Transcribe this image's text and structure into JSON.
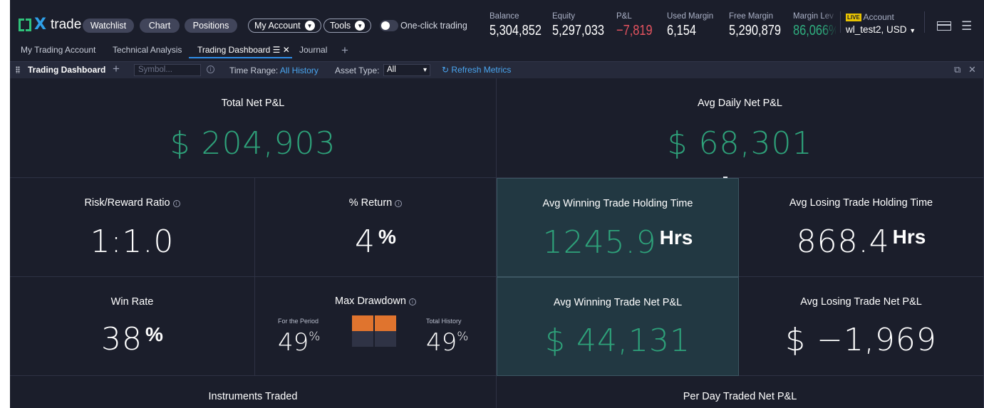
{
  "app": {
    "logo_text": "trade"
  },
  "nav": {
    "buttons": [
      "Watchlist",
      "Chart",
      "Positions"
    ],
    "dropdowns": [
      "My Account",
      "Tools"
    ],
    "one_click_label": "One-click trading"
  },
  "metrics": [
    {
      "label": "Balance",
      "value": "5,304,852"
    },
    {
      "label": "Equity",
      "value": "5,297,033"
    },
    {
      "label": "P&L",
      "value": "−7,819"
    },
    {
      "label": "Used Margin",
      "value": "6,154"
    },
    {
      "label": "Free Margin",
      "value": "5,290,879"
    },
    {
      "label": "Margin Lev",
      "value": "86,066%"
    }
  ],
  "account": {
    "live_badge": "LIVE",
    "label": "Account",
    "name": "wl_test2, USD"
  },
  "tabs": [
    "My Trading Account",
    "Technical Analysis",
    "Trading Dashboard",
    "Journal"
  ],
  "toolbar": {
    "title": "Trading Dashboard",
    "symbol_placeholder": "Symbol...",
    "time_range_label": "Time Range:",
    "time_range_value": "All History",
    "asset_type_label": "Asset Type:",
    "asset_type_value": "All",
    "refresh_label": "Refresh Metrics"
  },
  "dashboard": {
    "total_net_pl": {
      "title": "Total Net P&L",
      "value": "$ 204,903"
    },
    "avg_daily_net_pl": {
      "title": "Avg Daily Net P&L",
      "value": "$ 68,301"
    },
    "risk_reward": {
      "title": "Risk/Reward Ratio",
      "value": "1:1.0"
    },
    "pct_return": {
      "title": "% Return",
      "value": "4",
      "unit": "%"
    },
    "avg_win_hold": {
      "title": "Avg Winning Trade Holding Time",
      "value": "1245.9",
      "unit": "Hrs"
    },
    "avg_lose_hold": {
      "title": "Avg Losing Trade Holding Time",
      "value": "868.4",
      "unit": "Hrs"
    },
    "win_rate": {
      "title": "Win Rate",
      "value": "38",
      "unit": "%"
    },
    "max_drawdown": {
      "title": "Max Drawdown",
      "period_label": "For the Period",
      "period_value": "49",
      "history_label": "Total History",
      "history_value": "49",
      "unit": "%",
      "period_fraction": 0.49,
      "history_fraction": 0.49
    },
    "avg_win_pl": {
      "title": "Avg Winning Trade Net P&L",
      "value": "$ 44,131"
    },
    "avg_lose_pl": {
      "title": "Avg Losing Trade Net P&L",
      "value": "$ −1,969"
    },
    "instruments": {
      "title": "Instruments Traded"
    },
    "per_day": {
      "title": "Per Day Traded Net P&L"
    }
  },
  "colors": {
    "accent_green": "#2ea27a",
    "loss_red": "#e5535f",
    "link_blue": "#4aa6f0",
    "drawdown_orange": "#e0742e",
    "live_yellow": "#e9c400"
  }
}
